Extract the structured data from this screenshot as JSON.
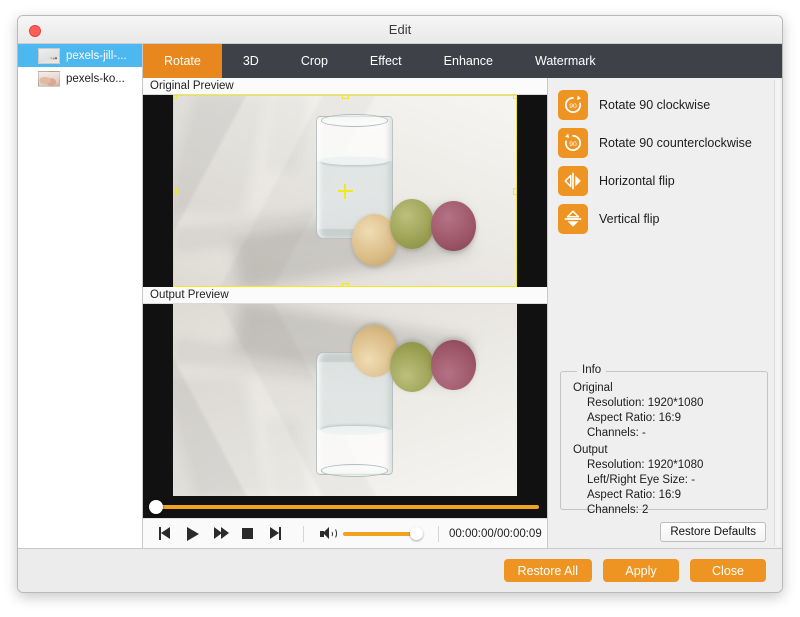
{
  "window": {
    "title": "Edit",
    "close_button": "close"
  },
  "sidebar": {
    "files": [
      {
        "name": "pexels-jill-...",
        "selected": true
      },
      {
        "name": "pexels-ko...",
        "selected": false
      }
    ]
  },
  "tabs": [
    {
      "label": "Rotate",
      "active": true
    },
    {
      "label": "3D",
      "active": false
    },
    {
      "label": "Crop",
      "active": false
    },
    {
      "label": "Effect",
      "active": false
    },
    {
      "label": "Enhance",
      "active": false
    },
    {
      "label": "Watermark",
      "active": false
    }
  ],
  "previews": {
    "original_label": "Original Preview",
    "output_label": "Output Preview"
  },
  "rotate_actions": [
    {
      "label": "Rotate 90 clockwise",
      "icon": "rotate-cw-90-icon"
    },
    {
      "label": "Rotate 90 counterclockwise",
      "icon": "rotate-ccw-90-icon"
    },
    {
      "label": "Horizontal flip",
      "icon": "horizontal-flip-icon"
    },
    {
      "label": "Vertical flip",
      "icon": "vertical-flip-icon"
    }
  ],
  "transport": {
    "previous": "previous-frame",
    "play": "play",
    "forward": "fast-forward",
    "stop": "stop",
    "next": "next-frame",
    "volume_icon": "speaker-icon",
    "volume_value": 100,
    "seek_value": 0,
    "timecode": "00:00:00/00:00:09"
  },
  "info": {
    "legend": "Info",
    "original": {
      "title": "Original",
      "lines": [
        "Resolution: 1920*1080",
        "Aspect Ratio: 16:9",
        "Channels: -"
      ]
    },
    "output": {
      "title": "Output",
      "lines": [
        "Resolution: 1920*1080",
        "Left/Right Eye Size: -",
        "Aspect Ratio: 16:9",
        "Channels: 2"
      ]
    }
  },
  "buttons": {
    "restore_defaults": "Restore Defaults",
    "restore_all": "Restore All",
    "apply": "Apply",
    "close": "Close"
  },
  "colors": {
    "accent_orange": "#ee9422",
    "tab_active": "#e8871e",
    "tabbar_dark": "#3e4147",
    "selection_blue": "#4db8f0",
    "crop_yellow": "#f2e81e",
    "close_red": "#ff5f57"
  }
}
